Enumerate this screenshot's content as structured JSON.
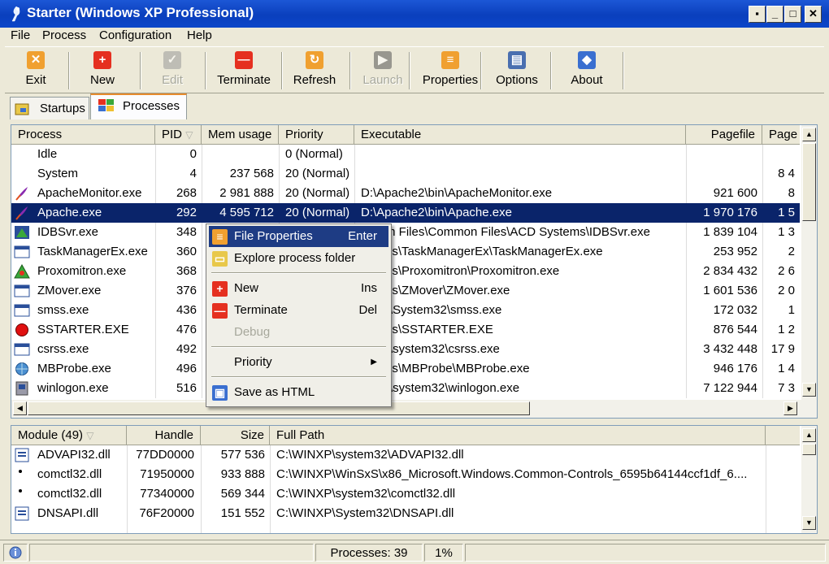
{
  "window": {
    "title": "Starter (Windows XP Professional)"
  },
  "caption_buttons": {
    "minimize": "_",
    "maximize": "□",
    "close": "✕",
    "extra": "▪"
  },
  "menu": [
    "File",
    "Process",
    "Configuration",
    "Help"
  ],
  "toolbar": [
    {
      "label": "Exit",
      "icon": "exit-icon",
      "color": "#f0a030",
      "glyph": "✕",
      "enabled": true
    },
    {
      "label": "New",
      "icon": "new-icon",
      "color": "#e53020",
      "glyph": "+",
      "enabled": true
    },
    {
      "label": "Edit",
      "icon": "edit-icon",
      "color": "#9a9a9a",
      "glyph": "✓",
      "enabled": false
    },
    {
      "label": "Terminate",
      "icon": "terminate-icon",
      "color": "#e53020",
      "glyph": "—",
      "enabled": true
    },
    {
      "label": "Refresh",
      "icon": "refresh-icon",
      "color": "#f0a030",
      "glyph": "↻",
      "enabled": true
    },
    {
      "label": "Launch",
      "icon": "launch-icon",
      "color": "#555555",
      "glyph": "▶",
      "enabled": false
    },
    {
      "label": "Properties",
      "icon": "properties-icon",
      "color": "#f0a030",
      "glyph": "≡",
      "enabled": true
    },
    {
      "label": "Options",
      "icon": "options-icon",
      "color": "#4a6fb0",
      "glyph": "▤",
      "enabled": true
    },
    {
      "label": "About",
      "icon": "about-icon",
      "color": "#3a6fd0",
      "glyph": "◆",
      "enabled": true
    }
  ],
  "tabs": [
    {
      "label": "Startups",
      "icon": "startups-icon",
      "active": false
    },
    {
      "label": "Processes",
      "icon": "processes-icon",
      "active": true
    }
  ],
  "process_table": {
    "headers": [
      "Process",
      "PID",
      "Mem usage",
      "Priority",
      "Executable",
      "Pagefile",
      "Page"
    ],
    "sort_arrow": "▽",
    "rows": [
      {
        "name": "Idle",
        "pid": "0",
        "mem": "",
        "priority": "0 (Normal)",
        "exe": "",
        "pagefile": "",
        "page": "",
        "icon": ""
      },
      {
        "name": "System",
        "pid": "4",
        "mem": "237 568",
        "priority": "20 (Normal)",
        "exe": "",
        "pagefile": "",
        "page": "8 4",
        "icon": ""
      },
      {
        "name": "ApacheMonitor.exe",
        "pid": "268",
        "mem": "2 981 888",
        "priority": "20 (Normal)",
        "exe": "D:\\Apache2\\bin\\ApacheMonitor.exe",
        "pagefile": "921 600",
        "page": "8",
        "icon": "apache-feather-icon"
      },
      {
        "name": "Apache.exe",
        "pid": "292",
        "mem": "4 595 712",
        "priority": "20 (Normal)",
        "exe": "D:\\Apache2\\bin\\Apache.exe",
        "pagefile": "1 970 176",
        "page": "1 5",
        "icon": "apache-feather-icon",
        "selected": true
      },
      {
        "name": "IDBSvr.exe",
        "pid": "348",
        "mem": "",
        "priority": "",
        "exe": "ogram Files\\Common Files\\ACD Systems\\IDBSvr.exe",
        "pagefile": "1 839 104",
        "page": "1 3",
        "icon": "idbsvr-icon"
      },
      {
        "name": "TaskManagerEx.exe",
        "pid": "360",
        "mem": "",
        "priority": "",
        "exe": "inApps\\TaskManagerEx\\TaskManagerEx.exe",
        "pagefile": "253 952",
        "page": "2",
        "icon": "window-icon"
      },
      {
        "name": "Proxomitron.exe",
        "pid": "368",
        "mem": "",
        "priority": "",
        "exe": "inApps\\Proxomitron\\Proxomitron.exe",
        "pagefile": "2 834 432",
        "page": "2 6",
        "icon": "proxomitron-icon"
      },
      {
        "name": "ZMover.exe",
        "pid": "376",
        "mem": "",
        "priority": "",
        "exe": "inApps\\ZMover\\ZMover.exe",
        "pagefile": "1 601 536",
        "page": "2 0",
        "icon": "window-icon"
      },
      {
        "name": "smss.exe",
        "pid": "436",
        "mem": "",
        "priority": "",
        "exe": "INXP\\System32\\smss.exe",
        "pagefile": "172 032",
        "page": "1",
        "icon": "window-icon"
      },
      {
        "name": "SSTARTER.EXE",
        "pid": "476",
        "mem": "",
        "priority": "",
        "exe": "inApps\\SSTARTER.EXE",
        "pagefile": "876 544",
        "page": "1 2",
        "icon": "red-circle-icon"
      },
      {
        "name": "csrss.exe",
        "pid": "492",
        "mem": "",
        "priority": "",
        "exe": "INXP\\system32\\csrss.exe",
        "pagefile": "3 432 448",
        "page": "17 9",
        "icon": "window-icon"
      },
      {
        "name": "MBProbe.exe",
        "pid": "496",
        "mem": "",
        "priority": "",
        "exe": "inApps\\MBProbe\\MBProbe.exe",
        "pagefile": "946 176",
        "page": "1 4",
        "icon": "globe-icon"
      },
      {
        "name": "winlogon.exe",
        "pid": "516",
        "mem": "",
        "priority": "",
        "exe": "INXP\\system32\\winlogon.exe",
        "pagefile": "7 122 944",
        "page": "7 3",
        "icon": "winlogon-icon"
      }
    ]
  },
  "context_menu": {
    "items": [
      {
        "label": "File Properties",
        "shortcut": "Enter",
        "icon": "file-properties-icon",
        "color": "#f0a030",
        "glyph": "≡",
        "highlighted": true
      },
      {
        "label": "Explore process folder",
        "shortcut": "",
        "icon": "folder-icon",
        "color": "#e8c84a",
        "glyph": "▭"
      },
      {
        "sep": true
      },
      {
        "label": "New",
        "shortcut": "Ins",
        "icon": "new-icon",
        "color": "#e53020",
        "glyph": "+"
      },
      {
        "label": "Terminate",
        "shortcut": "Del",
        "icon": "terminate-icon",
        "color": "#e53020",
        "glyph": "—"
      },
      {
        "label": "Debug",
        "shortcut": "",
        "icon": "",
        "disabled": true
      },
      {
        "sep": true
      },
      {
        "label": "Priority",
        "shortcut": "",
        "icon": "",
        "submenu": true,
        "arrow": "▶"
      },
      {
        "sep": true
      },
      {
        "label": "Save as HTML",
        "shortcut": "",
        "icon": "save-html-icon",
        "color": "#3a6fd0",
        "glyph": "▣"
      }
    ]
  },
  "module_table": {
    "headers": [
      "Module (49)",
      "Handle",
      "Size",
      "Full Path"
    ],
    "sort_arrow": "▽",
    "rows": [
      {
        "name": "ADVAPI32.dll",
        "handle": "77DD0000",
        "size": "577 536",
        "path": "C:\\WINXP\\system32\\ADVAPI32.dll",
        "icon": "dll-icon"
      },
      {
        "name": "comctl32.dll",
        "handle": "71950000",
        "size": "933 888",
        "path": "C:\\WINXP\\WinSxS\\x86_Microsoft.Windows.Common-Controls_6595b64144ccf1df_6....",
        "icon": "bullet-icon"
      },
      {
        "name": "comctl32.dll",
        "handle": "77340000",
        "size": "569 344",
        "path": "C:\\WINXP\\system32\\comctl32.dll",
        "icon": "bullet-icon"
      },
      {
        "name": "DNSAPI.dll",
        "handle": "76F20000",
        "size": "151 552",
        "path": "C:\\WINXP\\System32\\DNSAPI.dll",
        "icon": "dll-icon"
      }
    ]
  },
  "status": {
    "processes": "Processes: 39",
    "cpu": "1%"
  }
}
